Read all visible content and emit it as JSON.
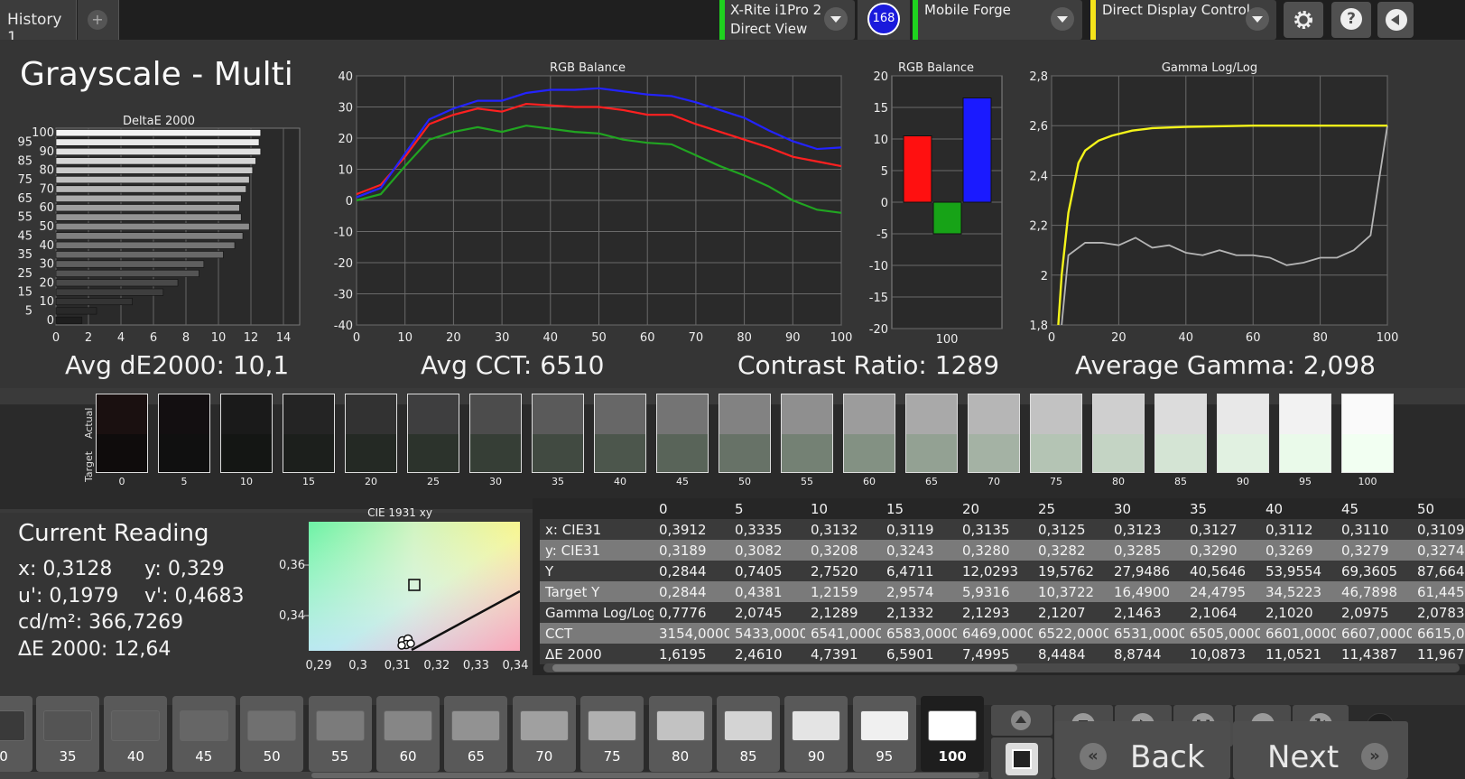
{
  "tabs": {
    "history": "History 1",
    "add": "+"
  },
  "devices": {
    "meter_line1": "X-Rite i1Pro 2",
    "meter_line2": "Direct View",
    "badge": "168",
    "generator": "Mobile Forge",
    "display": "Direct Display Control"
  },
  "icons": {
    "settings": "gear-icon",
    "help": "help-icon",
    "back": "collapse-left-icon"
  },
  "colors": {
    "meter_bar": "#1fd31f",
    "generator_bar": "#1fd31f",
    "display_bar": "#f5e31a",
    "badge": "#1a1adc"
  },
  "page_title": "Grayscale - Multi",
  "stats": {
    "avg_de": "Avg dE2000: 10,1",
    "avg_cct": "Avg CCT: 6510",
    "contrast": "Contrast Ratio: 1289",
    "avg_gamma": "Average Gamma: 2,098"
  },
  "delta_chart": {
    "title": "DeltaE 2000",
    "levels": [
      "100",
      "95",
      "90",
      "85",
      "80",
      "75",
      "70",
      "65",
      "60",
      "55",
      "50",
      "45",
      "40",
      "35",
      "30",
      "25",
      "20",
      "15",
      "10",
      "5",
      "0"
    ],
    "values": [
      12.6,
      12.5,
      12.6,
      12.3,
      12.1,
      11.9,
      11.7,
      11.4,
      11.3,
      11.4,
      11.9,
      11.5,
      11.0,
      10.3,
      9.1,
      8.8,
      7.5,
      6.6,
      4.7,
      2.5,
      1.6
    ],
    "x_ticks": [
      "0",
      "2",
      "4",
      "6",
      "8",
      "10",
      "12",
      "14"
    ],
    "y_ticks": [
      "100",
      "95",
      "90",
      "85",
      "80",
      "75",
      "70",
      "65",
      "60",
      "55",
      "50",
      "45",
      "40",
      "35",
      "30",
      "25",
      "20",
      "15",
      "10",
      "5",
      "0"
    ],
    "xlim": [
      0,
      15
    ]
  },
  "rgb_balance_chart": {
    "title": "RGB Balance",
    "type": "line",
    "x": [
      0,
      5,
      10,
      15,
      20,
      25,
      30,
      35,
      40,
      45,
      50,
      55,
      60,
      65,
      70,
      75,
      80,
      85,
      90,
      95,
      100
    ],
    "x_ticks": [
      "0",
      "10",
      "20",
      "30",
      "40",
      "50",
      "60",
      "70",
      "80",
      "90",
      "100"
    ],
    "y_ticks": [
      "40",
      "30",
      "20",
      "10",
      "0",
      "-10",
      "-20",
      "-30",
      "-40"
    ],
    "ylim": [
      -40,
      40
    ],
    "series": [
      {
        "color": "#ff2020",
        "values": [
          2,
          5,
          14,
          24.5,
          27.5,
          29.5,
          28.5,
          31,
          30.5,
          30,
          30,
          29,
          27.5,
          27.5,
          24.5,
          22,
          19.5,
          17,
          14,
          12.5,
          11
        ]
      },
      {
        "color": "#21a521",
        "values": [
          0,
          2,
          11,
          19.5,
          22,
          23.5,
          22,
          24,
          23,
          22,
          21.5,
          19.5,
          18.5,
          18,
          14.5,
          11,
          8,
          4.5,
          0,
          -3,
          -4
        ]
      },
      {
        "color": "#2323ff",
        "values": [
          1,
          4,
          15,
          26,
          29.5,
          32,
          32,
          34.5,
          35.5,
          35.5,
          36,
          35,
          34,
          33.5,
          31.5,
          29,
          26.5,
          22.5,
          19,
          16.5,
          17
        ]
      }
    ]
  },
  "rgb_bar_chart": {
    "title": "RGB Balance",
    "type": "bar",
    "categories": [
      "R",
      "G",
      "B"
    ],
    "values": [
      10.5,
      -5,
      16.5
    ],
    "colors": [
      "#ff1010",
      "#17a317",
      "#1a1aff"
    ],
    "x_tick": "100",
    "y_ticks": [
      "20",
      "15",
      "10",
      "5",
      "0",
      "-5",
      "-10",
      "-15",
      "-20"
    ],
    "ylim": [
      -20,
      20
    ]
  },
  "gamma_chart": {
    "title": "Gamma Log/Log",
    "type": "line",
    "x_ticks": [
      "0",
      "20",
      "40",
      "60",
      "80",
      "100"
    ],
    "y_ticks": [
      "2,8",
      "2,6",
      "2,4",
      "2,2",
      "2",
      "1,8"
    ],
    "ylim": [
      1.8,
      2.8
    ],
    "target": {
      "color": "#f5f51a",
      "x": [
        2,
        3,
        5,
        8,
        10,
        14,
        18,
        24,
        30,
        40,
        60,
        80,
        100
      ],
      "values": [
        1.8,
        2.0,
        2.25,
        2.45,
        2.5,
        2.54,
        2.56,
        2.58,
        2.59,
        2.595,
        2.6,
        2.6,
        2.6
      ]
    },
    "measured": {
      "color": "#b5b5b5",
      "x": [
        3,
        5,
        10,
        15,
        20,
        25,
        30,
        35,
        40,
        45,
        50,
        55,
        60,
        65,
        70,
        75,
        80,
        85,
        90,
        95,
        100
      ],
      "values": [
        1.8,
        2.08,
        2.13,
        2.13,
        2.12,
        2.15,
        2.11,
        2.12,
        2.09,
        2.08,
        2.1,
        2.08,
        2.08,
        2.07,
        2.04,
        2.05,
        2.07,
        2.07,
        2.1,
        2.16,
        2.6
      ]
    }
  },
  "swatches": {
    "actual_label": "Actual",
    "target_label": "Target",
    "levels": [
      "0",
      "5",
      "10",
      "15",
      "20",
      "25",
      "30",
      "35",
      "40",
      "45",
      "50",
      "55",
      "60",
      "65",
      "70",
      "75",
      "80",
      "85",
      "90",
      "95",
      "100"
    ],
    "actual_colors": [
      "#1a1010",
      "#130f11",
      "#1a1a1a",
      "#242424",
      "#323232",
      "#3e3e3f",
      "#4c4c4c",
      "#5a5a5a",
      "#676767",
      "#747474",
      "#828282",
      "#8f8f8f",
      "#9c9c9c",
      "#a9a9a9",
      "#b6b6b6",
      "#c2c2c2",
      "#cfcfcf",
      "#dcdcdc",
      "#e8e8e8",
      "#f2f2f2",
      "#fafafa"
    ],
    "target_colors": [
      "#0f0c0c",
      "#101010",
      "#141614",
      "#1c1f1c",
      "#242924",
      "#2c332c",
      "#363e36",
      "#414a41",
      "#4c564c",
      "#596459",
      "#677267",
      "#748174",
      "#839183",
      "#93a193",
      "#a4b2a4",
      "#b4c4b4",
      "#c4d4c4",
      "#d4e4d4",
      "#e1f1e1",
      "#eafaea",
      "#f2fff2"
    ]
  },
  "current_reading": {
    "title": "Current Reading",
    "x": "x: 0,3128",
    "y": "y: 0,329",
    "u": "u': 0,1979",
    "v": "v': 0,4683",
    "cdm2": "cd/m²: 366,7269",
    "de": "ΔE 2000: 12,64"
  },
  "cie_chart": {
    "title": "CIE 1931 xy",
    "x_ticks": [
      "0,29",
      "0,3",
      "0,31",
      "0,32",
      "0,33",
      "0,34"
    ],
    "y_ticks": [
      "0,36",
      "0,34"
    ],
    "target_x": 0.3127,
    "target_y": 0.329
  },
  "results_table": {
    "columns": [
      "0",
      "5",
      "10",
      "15",
      "20",
      "25",
      "30",
      "35",
      "40",
      "45",
      "50"
    ],
    "rows": [
      {
        "label": "x: CIE31",
        "values": [
          "0,3912",
          "0,3335",
          "0,3132",
          "0,3119",
          "0,3135",
          "0,3125",
          "0,3123",
          "0,3127",
          "0,3112",
          "0,3110",
          "0,3109"
        ]
      },
      {
        "label": "y: CIE31",
        "values": [
          "0,3189",
          "0,3082",
          "0,3208",
          "0,3243",
          "0,3280",
          "0,3282",
          "0,3285",
          "0,3290",
          "0,3269",
          "0,3279",
          "0,3274"
        ]
      },
      {
        "label": "Y",
        "values": [
          "0,2844",
          "0,7405",
          "2,7520",
          "6,4711",
          "12,0293",
          "19,5762",
          "27,9486",
          "40,5646",
          "53,9554",
          "69,3605",
          "87,664"
        ]
      },
      {
        "label": "Target Y",
        "values": [
          "0,2844",
          "0,4381",
          "1,2159",
          "2,9574",
          "5,9316",
          "10,3722",
          "16,4900",
          "24,4795",
          "34,5223",
          "46,7898",
          "61,445"
        ]
      },
      {
        "label": "Gamma Log/Log",
        "values": [
          "0,7776",
          "2,0745",
          "2,1289",
          "2,1332",
          "2,1293",
          "2,1207",
          "2,1463",
          "2,1064",
          "2,1020",
          "2,0975",
          "2,0783"
        ]
      },
      {
        "label": "CCT",
        "values": [
          "3154,0000",
          "5433,0000",
          "6541,0000",
          "6583,0000",
          "6469,0000",
          "6522,0000",
          "6531,0000",
          "6505,0000",
          "6601,0000",
          "6607,0000",
          "6615,0"
        ]
      },
      {
        "label": "ΔE 2000",
        "values": [
          "1,6195",
          "2,4610",
          "4,7391",
          "6,5901",
          "7,4995",
          "8,4484",
          "8,8744",
          "10,0873",
          "11,0521",
          "11,4387",
          "11,967"
        ]
      }
    ]
  },
  "patch_strip": {
    "levels": [
      "0",
      "35",
      "40",
      "45",
      "50",
      "55",
      "60",
      "65",
      "70",
      "75",
      "80",
      "85",
      "90",
      "95",
      "100"
    ],
    "colors": [
      "#3a3a3a",
      "#545454",
      "#5d5d5d",
      "#666666",
      "#707070",
      "#7b7b7b",
      "#868686",
      "#929292",
      "#a0a0a0",
      "#b0b0b0",
      "#c2c2c2",
      "#d4d4d4",
      "#e4e4e4",
      "#f0f0f0",
      "#ffffff"
    ],
    "selected": "100"
  },
  "controls": {
    "back": "Back",
    "next": "Next",
    "icons": [
      "up-arrow-icon",
      "stop-icon",
      "play-icon",
      "continuous-measure-icon",
      "loop-icon",
      "refresh-icon",
      "record-icon"
    ]
  }
}
